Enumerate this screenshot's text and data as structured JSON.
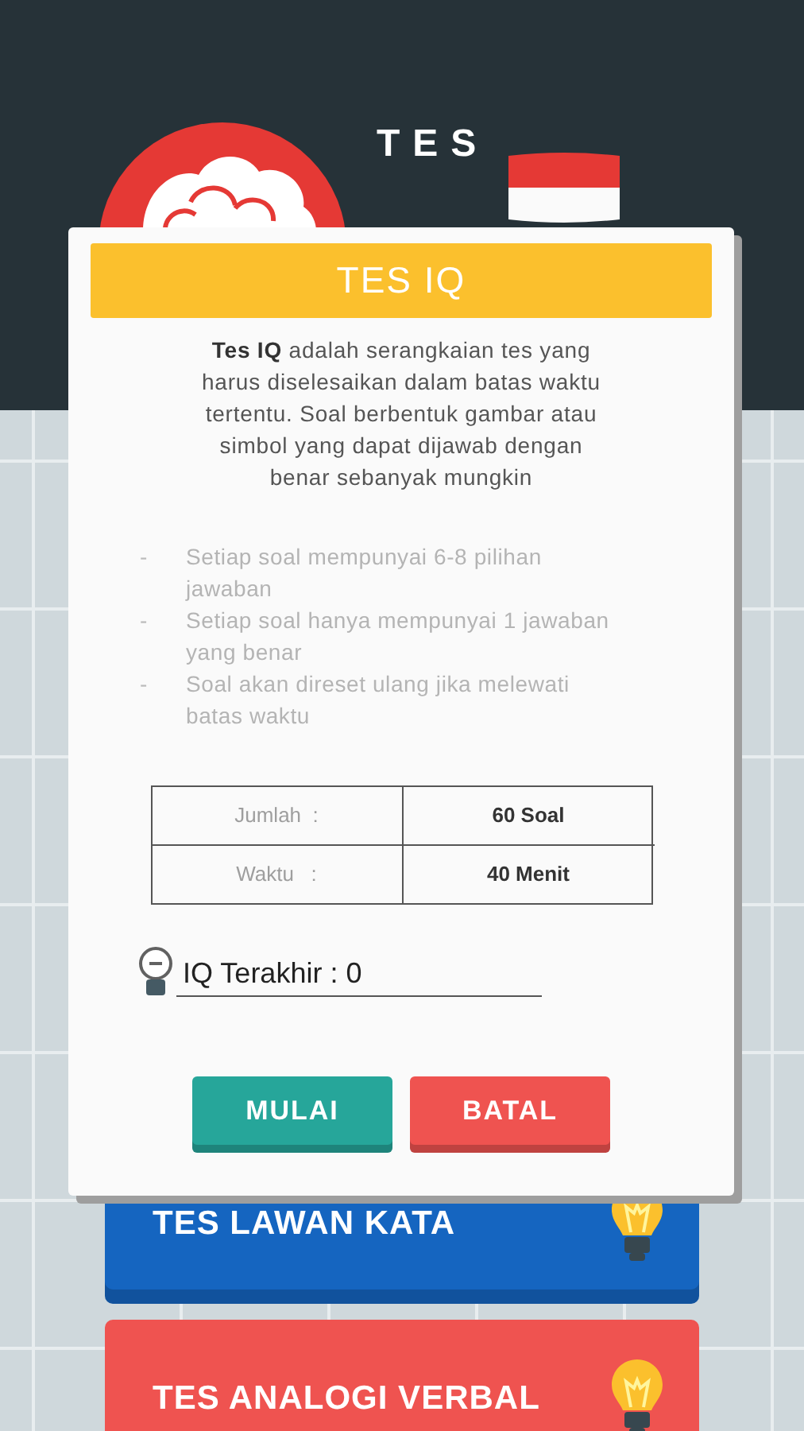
{
  "header": {
    "logo_top": "TES"
  },
  "menu": [
    {
      "label": "TES LAWAN KATA",
      "color": "#1565c0"
    },
    {
      "label": "TES ANALOGI VERBAL",
      "color": "#ef5350"
    }
  ],
  "dialog": {
    "title": "TES IQ",
    "description": "**Tes IQ** adalah serangkaian tes yang harus diselesaikan dalam batas waktu tertentu. Soal berbentuk gambar atau simbol yang dapat dijawab dengan benar sebanyak mungkin",
    "rules": [
      {
        "bullet": "-",
        "text": "Setiap soal mempunyai 6-8 pilihan jawaban"
      },
      {
        "bullet": "-",
        "text": "Setiap soal hanya mempunyai 1 jawaban yang benar"
      },
      {
        "bullet": "-",
        "text": "Soal akan direset ulang jika melewati batas waktu"
      }
    ],
    "info": [
      {
        "label": "Jumlah  :",
        "value": "60 Soal"
      },
      {
        "label": "Waktu   :",
        "value": "40 Menit"
      }
    ],
    "last_iq": "IQ Terakhir : 0",
    "buttons": [
      {
        "label": "MULAI",
        "kind": "start"
      },
      {
        "label": "BATAL",
        "kind": "cancel"
      }
    ]
  }
}
